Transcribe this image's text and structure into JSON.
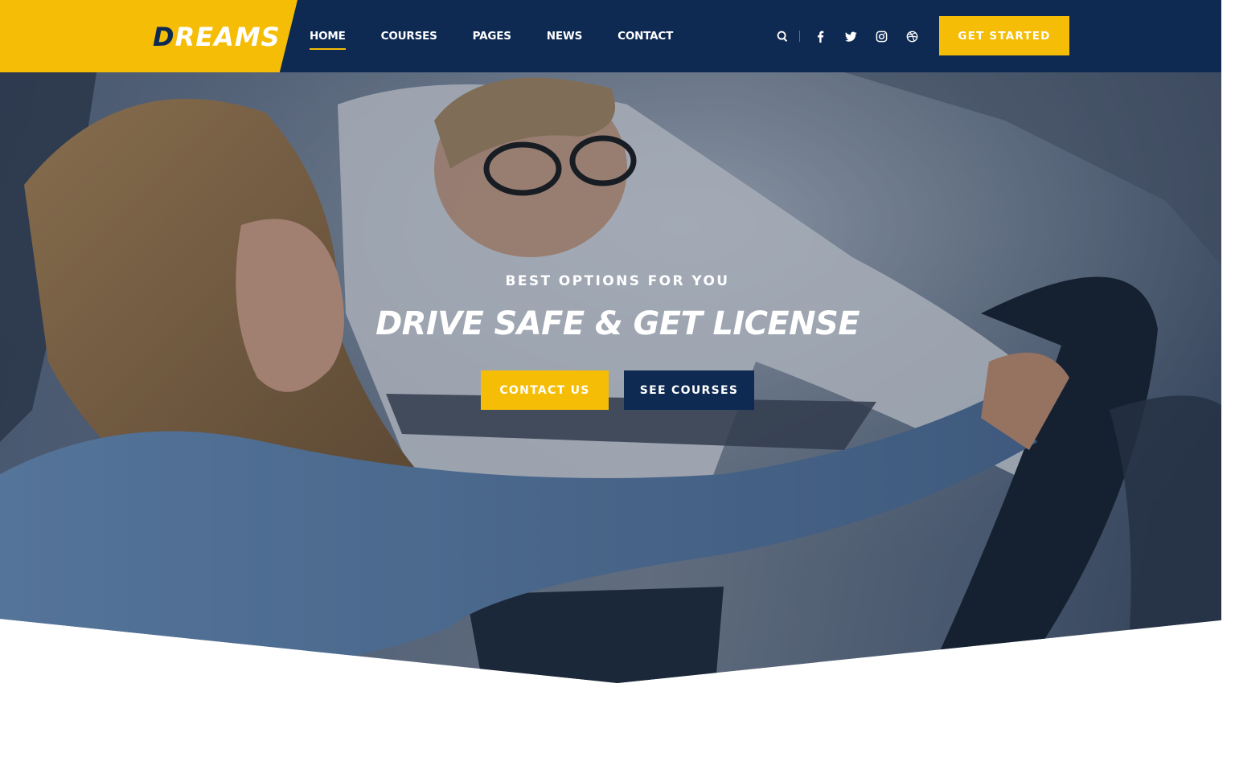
{
  "brand": {
    "logo_first": "D",
    "logo_rest": "REAMS",
    "accent_color": "#f5bd06",
    "primary_color": "#0e2a52"
  },
  "nav": {
    "items": [
      {
        "label": "HOME",
        "active": true
      },
      {
        "label": "COURSES",
        "active": false
      },
      {
        "label": "PAGES",
        "active": false
      },
      {
        "label": "NEWS",
        "active": false
      },
      {
        "label": "CONTACT",
        "active": false
      }
    ]
  },
  "header_icons": [
    "search-icon",
    "facebook-icon",
    "twitter-icon",
    "instagram-icon",
    "dribbble-icon"
  ],
  "header": {
    "cta_label": "GET STARTED"
  },
  "hero": {
    "kicker": "BEST OPTIONS FOR YOU",
    "headline": "DRIVE SAFE & GET LICENSE",
    "primary_button": "CONTACT US",
    "secondary_button": "SEE COURSES"
  }
}
